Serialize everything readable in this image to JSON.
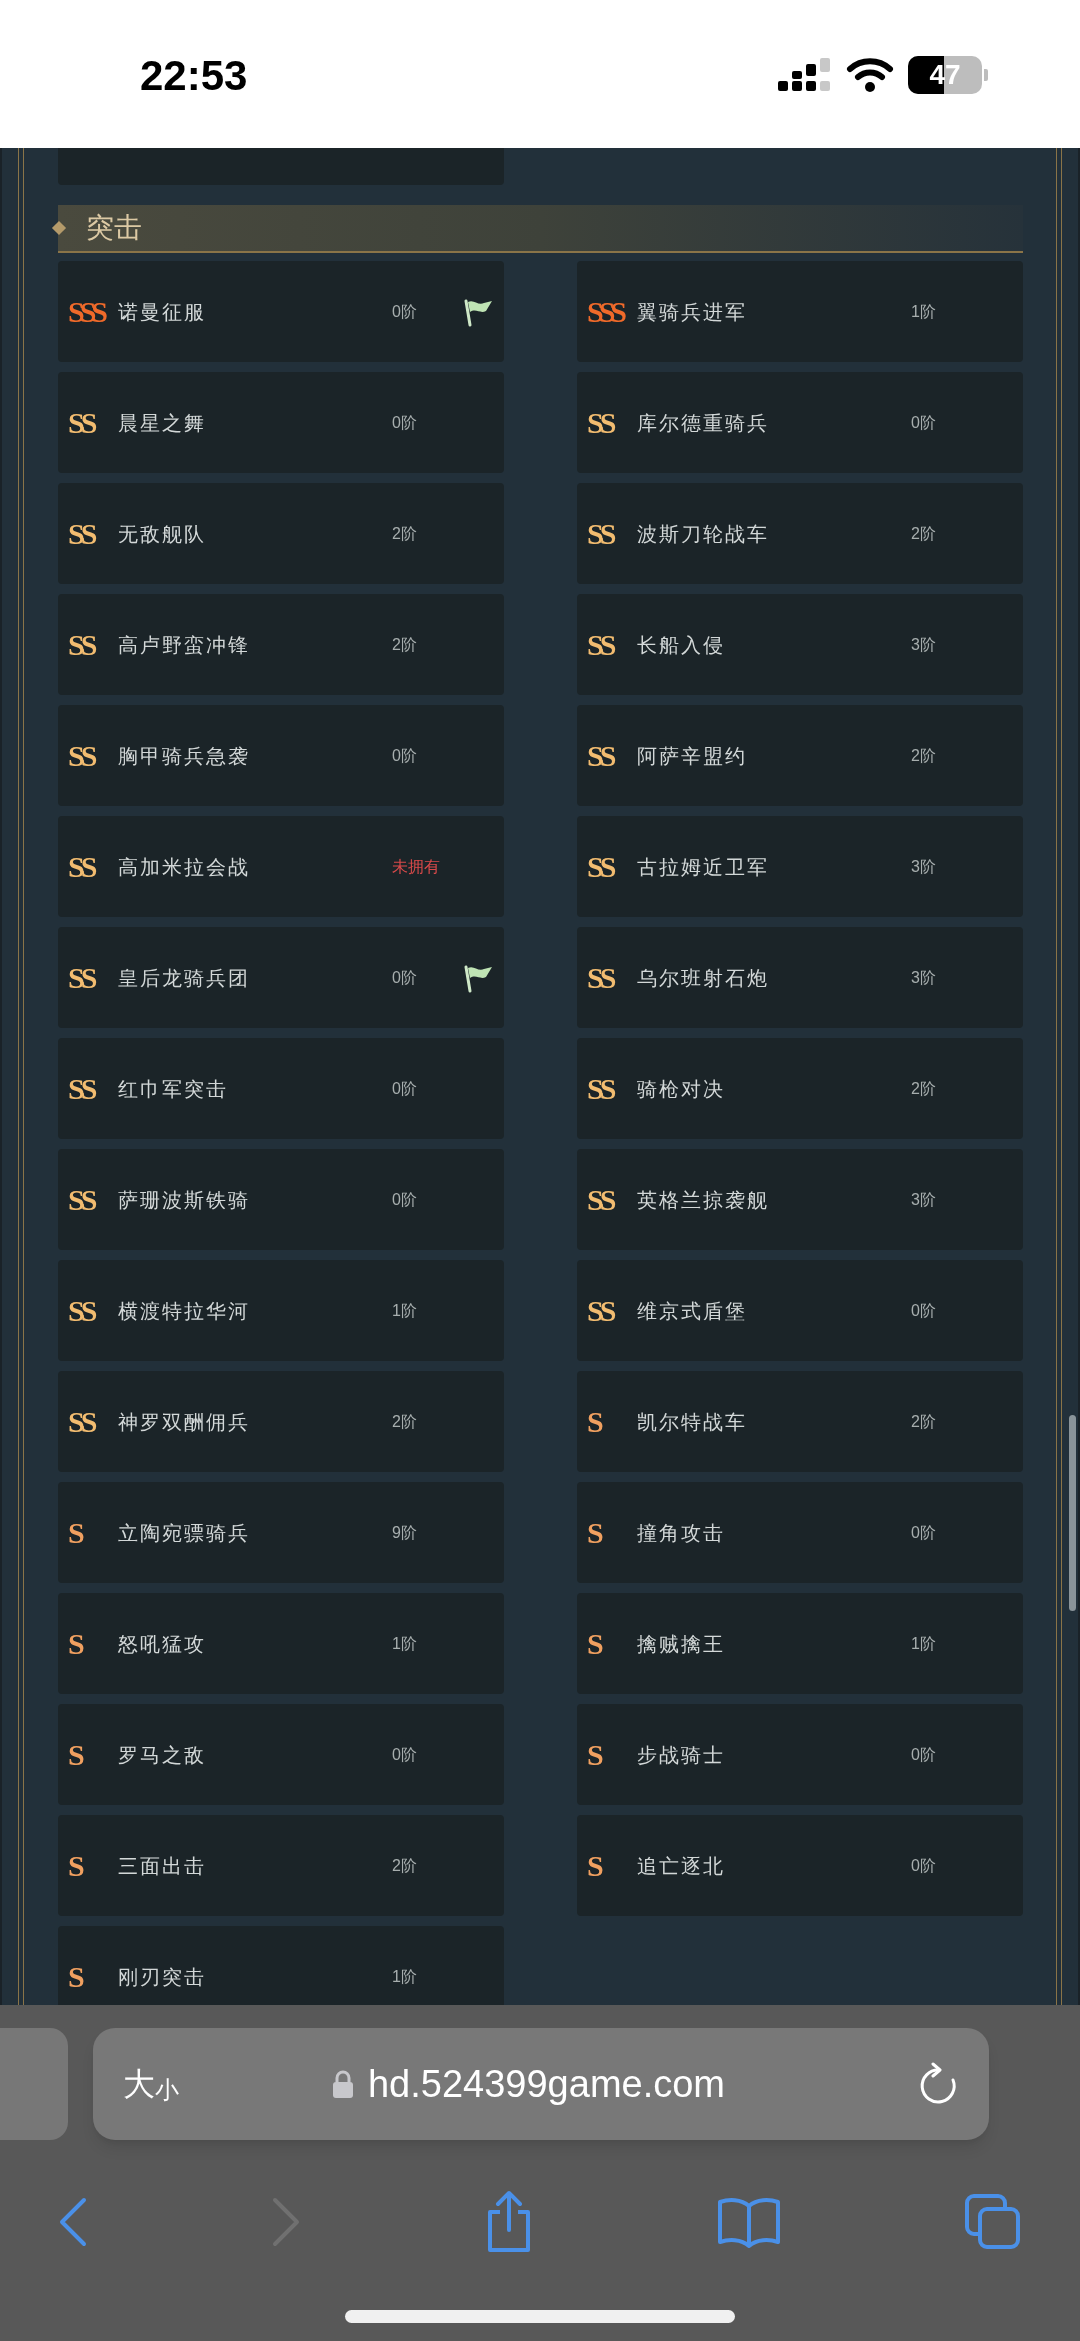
{
  "status_bar": {
    "time": "22:53",
    "battery": "47"
  },
  "section": {
    "title": "突击"
  },
  "cards": [
    {
      "badge": "SSS",
      "kind": "sss",
      "name": "诺曼征服",
      "level_text": "0阶",
      "owned": true,
      "flag": true
    },
    {
      "badge": "SSS",
      "kind": "sss",
      "name": "翼骑兵进军",
      "level_text": "1阶",
      "owned": true,
      "flag": false
    },
    {
      "badge": "SS",
      "kind": "ss",
      "name": "晨星之舞",
      "level_text": "0阶",
      "owned": true,
      "flag": false
    },
    {
      "badge": "SS",
      "kind": "ss",
      "name": "库尔德重骑兵",
      "level_text": "0阶",
      "owned": true,
      "flag": false
    },
    {
      "badge": "SS",
      "kind": "ss",
      "name": "无敌舰队",
      "level_text": "2阶",
      "owned": true,
      "flag": false
    },
    {
      "badge": "SS",
      "kind": "ss",
      "name": "波斯刀轮战车",
      "level_text": "2阶",
      "owned": true,
      "flag": false
    },
    {
      "badge": "SS",
      "kind": "ss",
      "name": "高卢野蛮冲锋",
      "level_text": "2阶",
      "owned": true,
      "flag": false
    },
    {
      "badge": "SS",
      "kind": "ss",
      "name": "长船入侵",
      "level_text": "3阶",
      "owned": true,
      "flag": false
    },
    {
      "badge": "SS",
      "kind": "ss",
      "name": "胸甲骑兵急袭",
      "level_text": "0阶",
      "owned": true,
      "flag": false
    },
    {
      "badge": "SS",
      "kind": "ss",
      "name": "阿萨辛盟约",
      "level_text": "2阶",
      "owned": true,
      "flag": false
    },
    {
      "badge": "SS",
      "kind": "ss",
      "name": "高加米拉会战",
      "level_text": "未拥有",
      "owned": false,
      "flag": false
    },
    {
      "badge": "SS",
      "kind": "ss",
      "name": "古拉姆近卫军",
      "level_text": "3阶",
      "owned": true,
      "flag": false
    },
    {
      "badge": "SS",
      "kind": "ss",
      "name": "皇后龙骑兵团",
      "level_text": "0阶",
      "owned": true,
      "flag": true
    },
    {
      "badge": "SS",
      "kind": "ss",
      "name": "乌尔班射石炮",
      "level_text": "3阶",
      "owned": true,
      "flag": false
    },
    {
      "badge": "SS",
      "kind": "ss",
      "name": "红巾军突击",
      "level_text": "0阶",
      "owned": true,
      "flag": false
    },
    {
      "badge": "SS",
      "kind": "ss",
      "name": "骑枪对决",
      "level_text": "2阶",
      "owned": true,
      "flag": false
    },
    {
      "badge": "SS",
      "kind": "ss",
      "name": "萨珊波斯铁骑",
      "level_text": "0阶",
      "owned": true,
      "flag": false
    },
    {
      "badge": "SS",
      "kind": "ss",
      "name": "英格兰掠袭舰",
      "level_text": "3阶",
      "owned": true,
      "flag": false
    },
    {
      "badge": "SS",
      "kind": "ss",
      "name": "横渡特拉华河",
      "level_text": "1阶",
      "owned": true,
      "flag": false
    },
    {
      "badge": "SS",
      "kind": "ss",
      "name": "维京式盾堡",
      "level_text": "0阶",
      "owned": true,
      "flag": false
    },
    {
      "badge": "SS",
      "kind": "ss",
      "name": "神罗双酬佣兵",
      "level_text": "2阶",
      "owned": true,
      "flag": false
    },
    {
      "badge": "S",
      "kind": "s",
      "name": "凯尔特战车",
      "level_text": "2阶",
      "owned": true,
      "flag": false
    },
    {
      "badge": "S",
      "kind": "s",
      "name": "立陶宛骠骑兵",
      "level_text": "9阶",
      "owned": true,
      "flag": false
    },
    {
      "badge": "S",
      "kind": "s",
      "name": "撞角攻击",
      "level_text": "0阶",
      "owned": true,
      "flag": false
    },
    {
      "badge": "S",
      "kind": "s",
      "name": "怒吼猛攻",
      "level_text": "1阶",
      "owned": true,
      "flag": false
    },
    {
      "badge": "S",
      "kind": "s",
      "name": "擒贼擒王",
      "level_text": "1阶",
      "owned": true,
      "flag": false
    },
    {
      "badge": "S",
      "kind": "s",
      "name": "罗马之敌",
      "level_text": "0阶",
      "owned": true,
      "flag": false
    },
    {
      "badge": "S",
      "kind": "s",
      "name": "步战骑士",
      "level_text": "0阶",
      "owned": true,
      "flag": false
    },
    {
      "badge": "S",
      "kind": "s",
      "name": "三面出击",
      "level_text": "2阶",
      "owned": true,
      "flag": false
    },
    {
      "badge": "S",
      "kind": "s",
      "name": "追亡逐北",
      "level_text": "0阶",
      "owned": true,
      "flag": false
    },
    {
      "badge": "S",
      "kind": "s",
      "name": "刚刃突击",
      "level_text": "1阶",
      "owned": true,
      "flag": false
    }
  ],
  "browser": {
    "text_size": {
      "large": "大",
      "small": "小"
    },
    "url": "hd.524399game.com"
  }
}
